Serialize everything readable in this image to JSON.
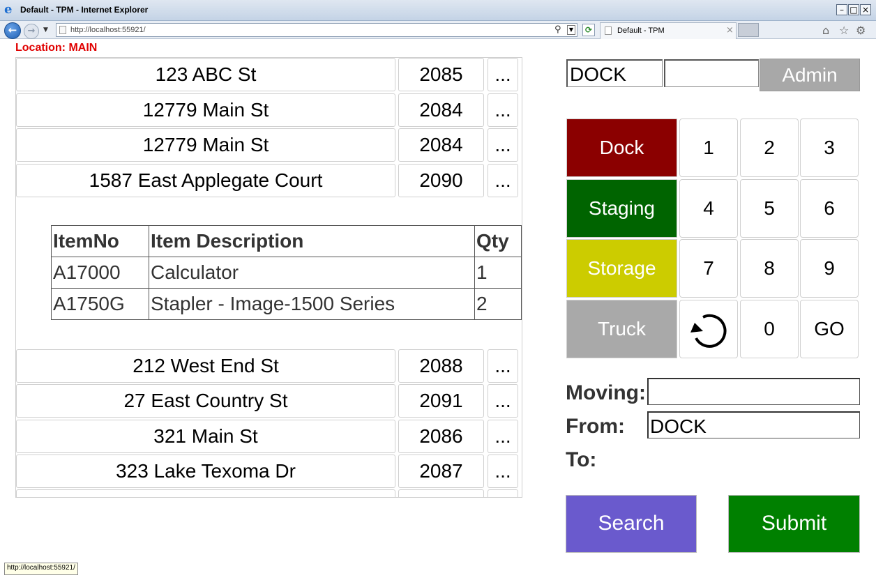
{
  "browser": {
    "title": "Default - TPM - Internet Explorer",
    "address": "http://localhost:55921/",
    "tab_title": "Default - TPM",
    "status_url": "http://localhost:55921/",
    "icons": [
      "ie-logo-icon",
      "back-icon",
      "forward-icon",
      "refresh-icon",
      "home-icon",
      "favorites-star-icon",
      "gear-icon"
    ]
  },
  "page": {
    "location_label": "Location: MAIN",
    "orders_top": [
      {
        "address": "123 ABC St",
        "number": "2085",
        "more": "..."
      },
      {
        "address": "12779 Main St",
        "number": "2084",
        "more": "..."
      },
      {
        "address": "12779 Main St",
        "number": "2084",
        "more": "..."
      },
      {
        "address": "1587 East Applegate Court",
        "number": "2090",
        "more": "..."
      }
    ],
    "items_table": {
      "headers": [
        "ItemNo",
        "Item Description",
        "Qty"
      ],
      "rows": [
        [
          "A17000",
          "Calculator",
          "1"
        ],
        [
          "A1750G",
          "Stapler - Image-1500 Series",
          "2"
        ]
      ]
    },
    "orders_bottom": [
      {
        "address": "212 West End St",
        "number": "2088",
        "more": "..."
      },
      {
        "address": "27 East Country St",
        "number": "2091",
        "more": "..."
      },
      {
        "address": "321 Main St",
        "number": "2086",
        "more": "..."
      },
      {
        "address": "323 Lake Texoma Dr",
        "number": "2087",
        "more": "..."
      }
    ]
  },
  "panel": {
    "location_value": "DOCK",
    "code_value": "",
    "admin_label": "Admin",
    "zones": [
      {
        "label": "Dock",
        "color": "#8b0000"
      },
      {
        "label": "Staging",
        "color": "#006400"
      },
      {
        "label": "Storage",
        "color": "#cccc00"
      },
      {
        "label": "Truck",
        "color": "#a9a9a9"
      }
    ],
    "keys": [
      "1",
      "2",
      "3",
      "4",
      "5",
      "6",
      "7",
      "8",
      "9",
      "0",
      "GO"
    ],
    "undo_icon": "rotate-ccw-icon",
    "moving_label": "Moving:",
    "moving_value": "",
    "from_label": "From:",
    "from_value": "DOCK",
    "to_label": "To:",
    "search_label": "Search",
    "submit_label": "Submit",
    "search_color": "#6a5acd",
    "submit_color": "#008000"
  }
}
